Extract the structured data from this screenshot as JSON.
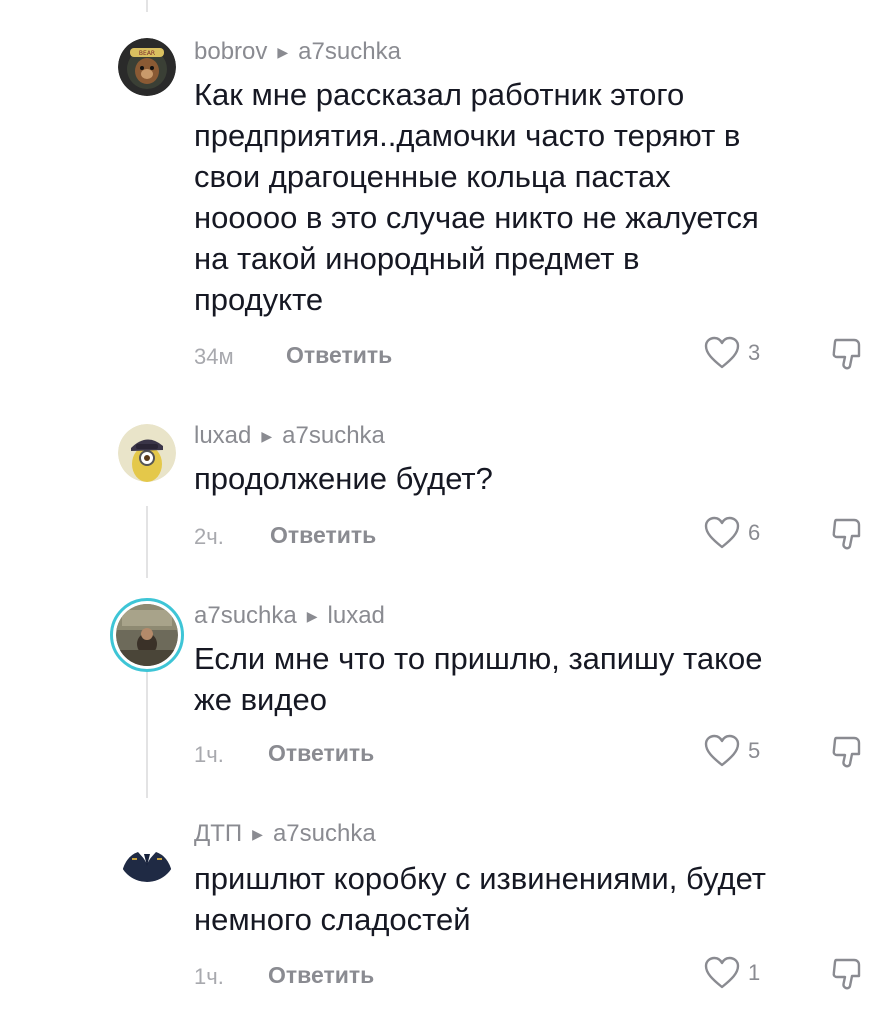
{
  "comments": [
    {
      "author": "bobrov",
      "reply_to": "a7suchka",
      "text": "Как мне рассказал работник этого\nпредприятия..дамочки часто теряют в\nсвои драгоценные кольца пастах\nнооооо в это случае никто не жалуется\nна такой инородный предмет в\nпродукте",
      "time": "34м",
      "reply_label": "Ответить",
      "likes": "3"
    },
    {
      "author": "luxad",
      "reply_to": "a7suchka",
      "text": "продолжение будет?",
      "time": "2ч.",
      "reply_label": "Ответить",
      "likes": "6"
    },
    {
      "author": "a7suchka",
      "reply_to": "luxad",
      "text": "Если мне что то пришлю, запишу такое\nже видео",
      "time": "1ч.",
      "reply_label": "Ответить",
      "likes": "5"
    },
    {
      "author": "ДТП",
      "reply_to": "a7suchka",
      "text": "пришлют коробку с извинениями, будет\nнемного сладостей",
      "time": "1ч.",
      "reply_label": "Ответить",
      "likes": "1"
    }
  ],
  "icons": {
    "like": "heart-outline-icon",
    "dislike": "thumbs-down-icon",
    "reply_arrow": "triangle-right-icon"
  },
  "colors": {
    "text": "#161823",
    "meta": "#8a8b91",
    "time": "#a8a9ae",
    "thread_line": "#e3e3e4",
    "story_ring": "#3ec5d6"
  }
}
